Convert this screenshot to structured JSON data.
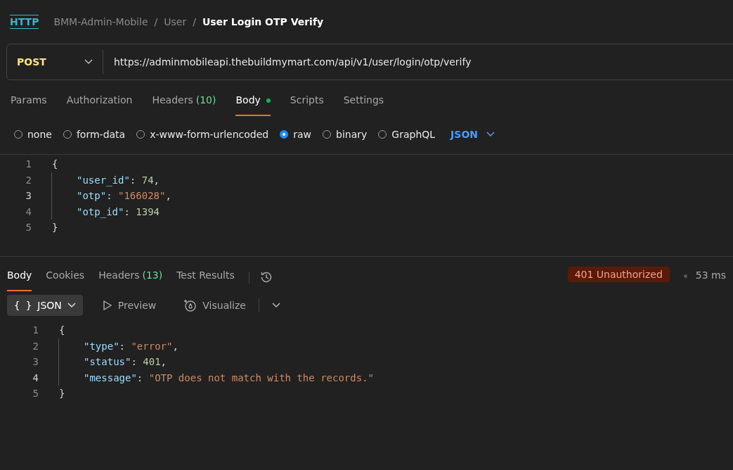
{
  "breadcrumb": {
    "icon_label": "HTTP",
    "items": [
      {
        "label": "BMM-Admin-Mobile",
        "current": false
      },
      {
        "label": "User",
        "current": false
      },
      {
        "label": "User Login OTP Verify",
        "current": true
      }
    ],
    "separator": "/"
  },
  "request": {
    "method": "POST",
    "url": "https://adminmobileapi.thebuildmymart.com/api/v1/user/login/otp/verify"
  },
  "request_tabs": [
    {
      "label": "Params",
      "selected": false
    },
    {
      "label": "Authorization",
      "selected": false
    },
    {
      "label": "Headers",
      "count": "(10)",
      "selected": false
    },
    {
      "label": "Body",
      "selected": true,
      "dot": true
    },
    {
      "label": "Scripts",
      "selected": false
    },
    {
      "label": "Settings",
      "selected": false
    }
  ],
  "body_types": [
    {
      "label": "none",
      "selected": false
    },
    {
      "label": "form-data",
      "selected": false
    },
    {
      "label": "x-www-form-urlencoded",
      "selected": false
    },
    {
      "label": "raw",
      "selected": true
    },
    {
      "label": "binary",
      "selected": false
    },
    {
      "label": "GraphQL",
      "selected": false
    }
  ],
  "body_format": "JSON",
  "request_body": [
    {
      "number": "1",
      "active": false,
      "indented": false,
      "tokens": [
        {
          "kind": "punct",
          "text": "{"
        }
      ]
    },
    {
      "number": "2",
      "active": false,
      "indented": true,
      "tokens": [
        {
          "kind": "key",
          "text": "\"user_id\""
        },
        {
          "kind": "punct",
          "text": ": "
        },
        {
          "kind": "number",
          "text": "74"
        },
        {
          "kind": "punct",
          "text": ","
        }
      ]
    },
    {
      "number": "3",
      "active": true,
      "indented": true,
      "tokens": [
        {
          "kind": "key",
          "text": "\"otp\""
        },
        {
          "kind": "punct",
          "text": ": "
        },
        {
          "kind": "string",
          "text": "\"166028\""
        },
        {
          "kind": "punct",
          "text": ","
        }
      ]
    },
    {
      "number": "4",
      "active": false,
      "indented": true,
      "tokens": [
        {
          "kind": "key",
          "text": "\"otp_id\""
        },
        {
          "kind": "punct",
          "text": ": "
        },
        {
          "kind": "number",
          "text": "1394"
        }
      ]
    },
    {
      "number": "5",
      "active": false,
      "indented": false,
      "tokens": [
        {
          "kind": "punct",
          "text": "}"
        }
      ]
    }
  ],
  "response_tabs": [
    {
      "label": "Body",
      "selected": true
    },
    {
      "label": "Cookies",
      "selected": false
    },
    {
      "label": "Headers",
      "count": "(13)",
      "selected": false
    },
    {
      "label": "Test Results",
      "selected": false
    }
  ],
  "response_status": {
    "code": "401 Unauthorized",
    "ok": false,
    "time": "53 ms"
  },
  "response_views": [
    {
      "label": "JSON",
      "kind": "format",
      "icon_text": "{ }",
      "selected": true
    },
    {
      "label": "Preview",
      "kind": "preview",
      "selected": false
    },
    {
      "label": "Visualize",
      "kind": "visualize",
      "selected": false
    }
  ],
  "response_body": [
    {
      "number": "1",
      "active": false,
      "indented": false,
      "tokens": [
        {
          "kind": "punct",
          "text": "{"
        }
      ]
    },
    {
      "number": "2",
      "active": false,
      "indented": true,
      "tokens": [
        {
          "kind": "key",
          "text": "\"type\""
        },
        {
          "kind": "punct",
          "text": ": "
        },
        {
          "kind": "string",
          "text": "\"error\""
        },
        {
          "kind": "punct",
          "text": ","
        }
      ]
    },
    {
      "number": "3",
      "active": false,
      "indented": true,
      "tokens": [
        {
          "kind": "key",
          "text": "\"status\""
        },
        {
          "kind": "punct",
          "text": ": "
        },
        {
          "kind": "number",
          "text": "401"
        },
        {
          "kind": "punct",
          "text": ","
        }
      ]
    },
    {
      "number": "4",
      "active": true,
      "indented": true,
      "tokens": [
        {
          "kind": "key",
          "text": "\"message\""
        },
        {
          "kind": "punct",
          "text": ": "
        },
        {
          "kind": "string",
          "text": "\"OTP does not match with the records.\""
        }
      ]
    },
    {
      "number": "5",
      "active": false,
      "indented": false,
      "tokens": [
        {
          "kind": "punct",
          "text": "}"
        }
      ]
    }
  ]
}
